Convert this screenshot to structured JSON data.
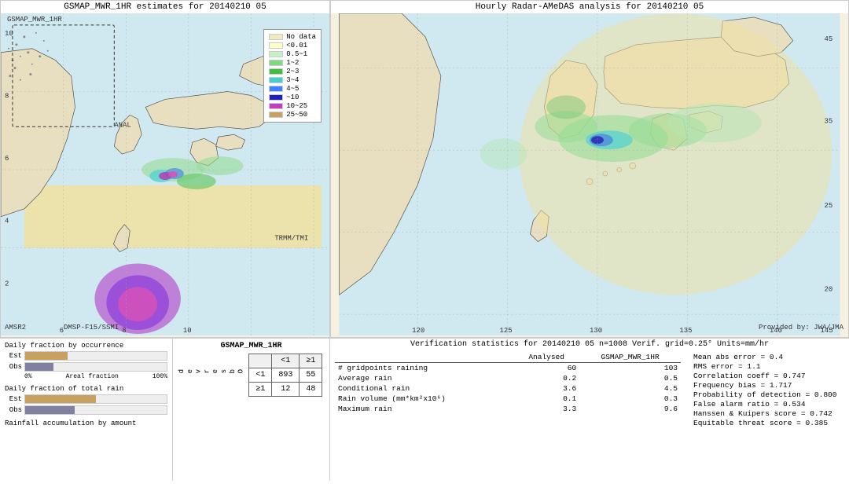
{
  "left_map": {
    "title": "GSMAP_MWR_1HR estimates for 20140210 05",
    "labels": {
      "amsr2": "AMSR2",
      "dmsp": "DMSP-F15/SSMI",
      "trmm": "TRMM/TMI",
      "anal": "ANAL"
    }
  },
  "right_map": {
    "title": "Hourly Radar-AMeDAS analysis for 20140210 05",
    "provided_by": "Provided by: JWA/JMA"
  },
  "legend": {
    "items": [
      {
        "label": "No data",
        "color": "#f0e8c0"
      },
      {
        "label": "<0.01",
        "color": "#ffffc0"
      },
      {
        "label": "0.5~1",
        "color": "#c8f0c8"
      },
      {
        "label": "1~2",
        "color": "#80d880"
      },
      {
        "label": "2~3",
        "color": "#40c040"
      },
      {
        "label": "3~4",
        "color": "#40d0d0"
      },
      {
        "label": "4~5",
        "color": "#4080ff"
      },
      {
        "label": "~10",
        "color": "#2020c0"
      },
      {
        "label": "10~25",
        "color": "#c040c0"
      },
      {
        "label": "25~50",
        "color": "#c8a060"
      }
    ]
  },
  "charts": {
    "occurrence_title": "Daily fraction by occurrence",
    "rain_title": "Daily fraction of total rain",
    "accumulation_title": "Rainfall accumulation by amount",
    "est_label": "Est",
    "obs_label": "Obs",
    "zero_label": "0%",
    "hundred_label": "Areal fraction",
    "hundred_pct": "100%"
  },
  "contingency": {
    "title": "GSMAP_MWR_1HR",
    "col_labels": [
      "<1",
      "≥1"
    ],
    "obs_label": "O\nb\ns\ne\nr\nv\ne\nd",
    "row_labels": [
      "<1",
      "≥1"
    ],
    "cells": [
      [
        893,
        55
      ],
      [
        12,
        48
      ]
    ]
  },
  "verification": {
    "title": "Verification statistics for 20140210 05  n=1008  Verif. grid=0.25°  Units=mm/hr",
    "headers": [
      "",
      "Analysed",
      "GSMAP_MWR_1HR"
    ],
    "rows": [
      {
        "label": "# gridpoints raining",
        "analysed": "60",
        "gsmap": "103"
      },
      {
        "label": "Average rain",
        "analysed": "0.2",
        "gsmap": "0.5"
      },
      {
        "label": "Conditional rain",
        "analysed": "3.6",
        "gsmap": "4.5"
      },
      {
        "label": "Rain volume (mm*km²x10⁶)",
        "analysed": "0.1",
        "gsmap": "0.3"
      },
      {
        "label": "Maximum rain",
        "analysed": "3.3",
        "gsmap": "9.6"
      }
    ],
    "scores": [
      {
        "label": "Mean abs error = 0.4"
      },
      {
        "label": "RMS error = 1.1"
      },
      {
        "label": "Correlation coeff = 0.747"
      },
      {
        "label": "Frequency bias = 1.717"
      },
      {
        "label": "Probability of detection = 0.800"
      },
      {
        "label": "False alarm ratio = 0.534"
      },
      {
        "label": "Hanssen & Kuipers score = 0.742"
      },
      {
        "label": "Equitable threat score = 0.385"
      }
    ]
  }
}
